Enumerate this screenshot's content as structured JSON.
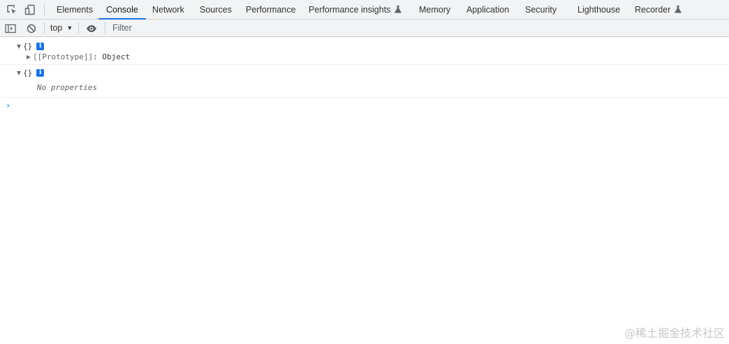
{
  "devtools": {
    "tabs": [
      {
        "label": "Elements"
      },
      {
        "label": "Console"
      },
      {
        "label": "Network"
      },
      {
        "label": "Sources"
      },
      {
        "label": "Performance"
      },
      {
        "label": "Performance insights"
      },
      {
        "label": "Memory"
      },
      {
        "label": "Application"
      },
      {
        "label": "Security"
      },
      {
        "label": "Lighthouse"
      },
      {
        "label": "Recorder"
      }
    ],
    "active_tab": "Console",
    "accent_color": "#1a73e8"
  },
  "toolbar": {
    "context": "top",
    "filter_placeholder": "Filter",
    "icons": [
      "sidebar-toggle-icon",
      "clear-console-icon",
      "eye-icon"
    ]
  },
  "console": {
    "messages": [
      {
        "summary": "{}",
        "expanded": true,
        "children": [
          {
            "key": "[[Prototype]]",
            "separator": ": ",
            "value": "Object"
          }
        ]
      },
      {
        "summary": "{}",
        "expanded": true,
        "empty_text": "No properties"
      }
    ],
    "prompt": "›"
  },
  "watermark": "@稀土掘金技术社区"
}
